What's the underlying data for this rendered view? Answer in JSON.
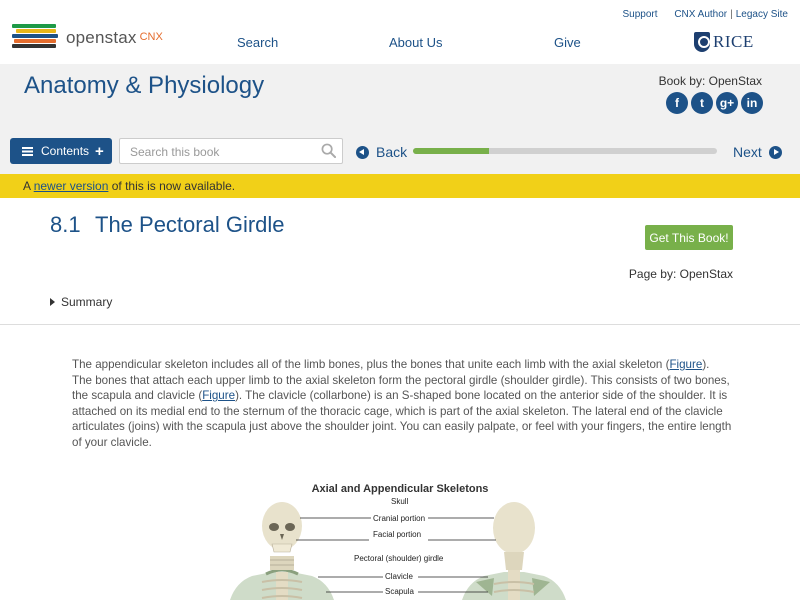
{
  "topbar": {
    "logo_word": "openstax",
    "logo_cnx": "CNX",
    "nav": [
      "Search",
      "About Us",
      "Give"
    ],
    "util": {
      "support": "Support",
      "author": "CNX Author",
      "legacy": "Legacy Site"
    },
    "rice": "RICE"
  },
  "book": {
    "title": "Anatomy & Physiology",
    "book_by": "Book by: OpenStax",
    "social": [
      {
        "icon": "facebook-icon",
        "glyph": "f"
      },
      {
        "icon": "twitter-icon",
        "glyph": "t"
      },
      {
        "icon": "google-plus-icon",
        "glyph": "g+"
      },
      {
        "icon": "linkedin-icon",
        "glyph": "in"
      }
    ]
  },
  "toolbar": {
    "contents_label": "Contents",
    "search_placeholder": "Search this book",
    "back_label": "Back",
    "next_label": "Next",
    "progress_fraction": 0.25
  },
  "notice": {
    "prefix": "A ",
    "link": "newer version",
    "suffix": " of this is now available."
  },
  "section": {
    "number": "8.1",
    "title": "The Pectoral Girdle",
    "get_book": "Get This Book!",
    "page_by": "Page by: OpenStax",
    "summary": "Summary"
  },
  "body": {
    "p1": "The appendicular skeleton includes all of the limb bones, plus the bones that unite each limb with the axial skeleton (",
    "link1": "Figure",
    "p2": "). The bones that attach each upper limb to the axial skeleton form the pectoral girdle (shoulder girdle). This consists of two bones, the scapula and clavicle (",
    "link2": "Figure",
    "p3": "). The clavicle (collarbone) is an S-shaped bone located on the anterior side of the shoulder. It is attached on its medial end to the sternum of the thoracic cage, which is part of the axial skeleton. The lateral end of the clavicle articulates (joins) with the scapula just above the shoulder joint. You can easily palpate, or feel with your fingers, the entire length of your clavicle."
  },
  "figure": {
    "title": "Axial and Appendicular Skeletons",
    "labels": {
      "skull": "Skull",
      "cranial": "Cranial portion",
      "facial": "Facial portion",
      "pectoral": "Pectoral (shoulder) girdle",
      "clavicle": "Clavicle",
      "scapula": "Scapula"
    }
  },
  "colors": {
    "brand_blue": "#1d5288",
    "green": "#78b04a",
    "notice_yellow": "#f1d018",
    "header_gray": "#f1f1f1"
  }
}
